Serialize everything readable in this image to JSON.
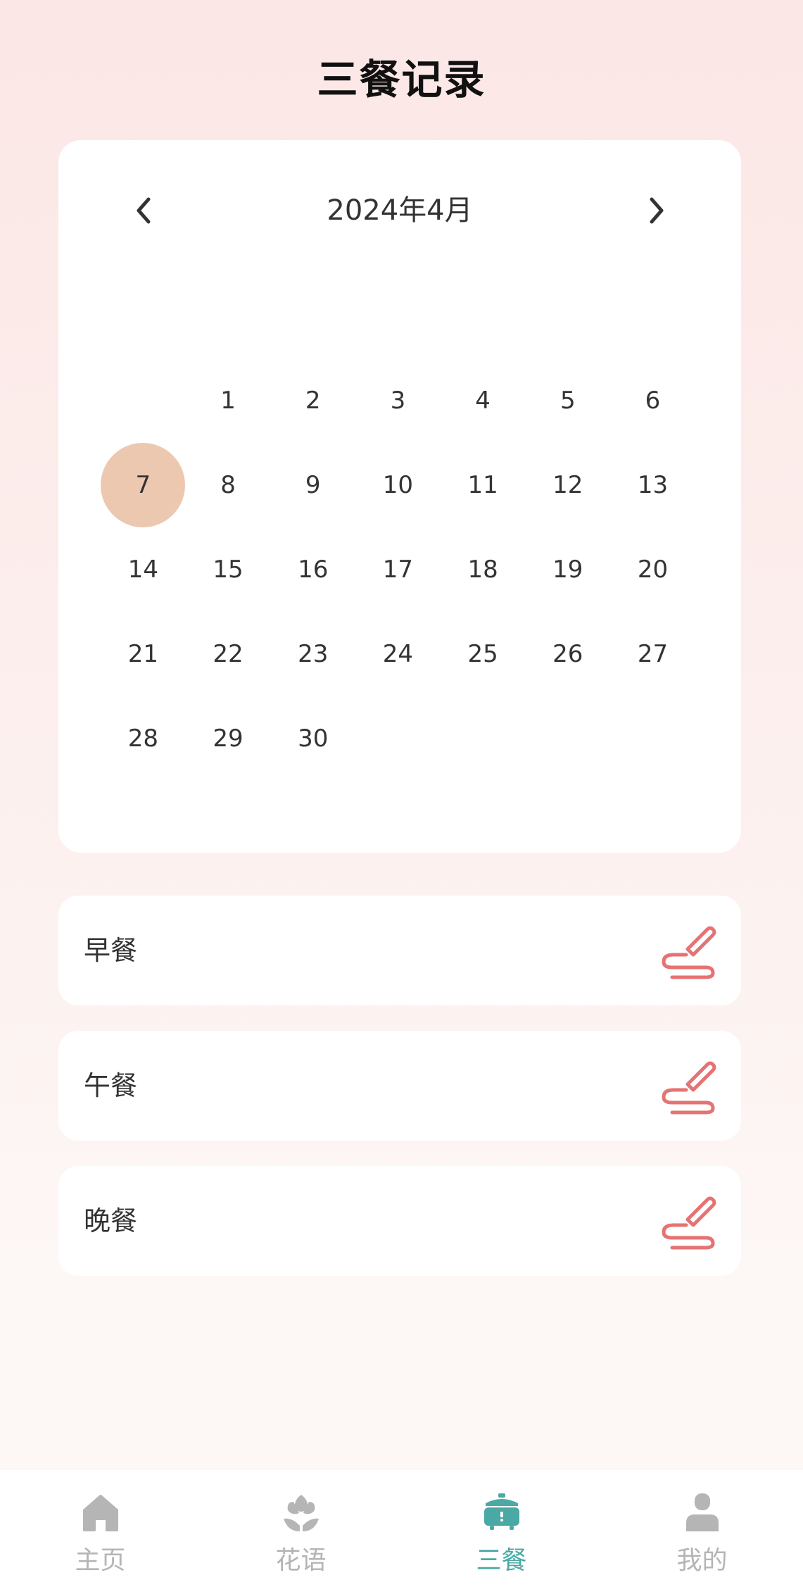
{
  "page": {
    "title": "三餐记录"
  },
  "calendar": {
    "month_label": "2024年4月",
    "selected_day": 7,
    "weekdays": [
      "",
      "",
      "",
      "",
      "",
      "",
      ""
    ],
    "weeks": [
      [
        "",
        "1",
        "2",
        "3",
        "4",
        "5",
        "6"
      ],
      [
        "7",
        "8",
        "9",
        "10",
        "11",
        "12",
        "13"
      ],
      [
        "14",
        "15",
        "16",
        "17",
        "18",
        "19",
        "20"
      ],
      [
        "21",
        "22",
        "23",
        "24",
        "25",
        "26",
        "27"
      ],
      [
        "28",
        "29",
        "30",
        "",
        "",
        "",
        ""
      ]
    ],
    "prev_icon": "chevron-left-icon",
    "next_icon": "chevron-right-icon"
  },
  "meals": [
    {
      "label": "早餐",
      "icon": "edit-icon"
    },
    {
      "label": "午餐",
      "icon": "edit-icon"
    },
    {
      "label": "晚餐",
      "icon": "edit-icon"
    }
  ],
  "bottom_nav": [
    {
      "label": "主页",
      "icon": "home-icon",
      "active": false
    },
    {
      "label": "花语",
      "icon": "flower-icon",
      "active": false
    },
    {
      "label": "三餐",
      "icon": "rice-cooker-icon",
      "active": true
    },
    {
      "label": "我的",
      "icon": "user-icon",
      "active": false
    }
  ],
  "colors": {
    "accent": "#4aa9a4",
    "selected_day": "#ecc8b1",
    "edit_icon": "#e57373",
    "inactive_nav": "#b5b5b5"
  }
}
